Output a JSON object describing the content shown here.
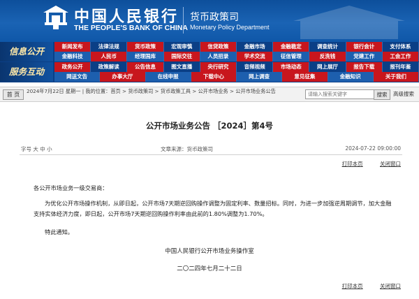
{
  "header": {
    "bank_cn": "中国人民银行",
    "bank_en": "THE PEOPLE'S BANK OF CHINA",
    "dept_cn": "货币政策司",
    "dept_en": "Monetary Policy Department"
  },
  "nav": {
    "group1_label": "信息公开",
    "group2_label": "服务互动",
    "row1": [
      "新闻发布",
      "法律法规",
      "货币政策",
      "宏观审慎",
      "信贷政策",
      "金融市场",
      "金融稳定",
      "调查统计",
      "银行会计",
      "支付体系"
    ],
    "row2": [
      "金融科技",
      "人民币",
      "经理国库",
      "国际交往",
      "人员招录",
      "学术交流",
      "征信管理",
      "反洗钱",
      "党建工作",
      "工会工作"
    ],
    "row3": [
      "政务公开",
      "政策解读",
      "公告信息",
      "图文直播",
      "央行研究",
      "音频视频",
      "市场动态",
      "网上展厅",
      "报告下载",
      "报刊年鉴"
    ],
    "row4": [
      "网送文告",
      "办事大厅",
      "在线申报",
      "下载中心",
      "网上调查",
      "意见征集",
      "金融知识",
      "关于我们"
    ]
  },
  "breadcrumb": {
    "home_label": "首 页",
    "text": "2024年7月22日 星期一 | 我的位置：首页 > 货币政策司 > 货币政策工具 > 公开市场业务 > 公开市场业务公告",
    "search_placeholder": "请输入搜索关键字",
    "search_label": "搜索",
    "advanced_label": "高级搜索"
  },
  "article": {
    "title": "公开市场业务公告 ［2024］第4号",
    "author": "字号  大  中  小",
    "source": "文章来源：货币政策司",
    "date": "2024-07-22  09:00:00",
    "print_label": "打印本页",
    "close_label": "关闭窗口",
    "greeting": "各公开市场业务一级交易商：",
    "paragraph1": "为优化公开市场操作机制，从即日起，公开市场7天期逆回购操作调整为固定利率、数量招标。同时，为进一步加强逆周期调节，加大金融支持实体经济力度，即日起，公开市场7天期逆回购操作利率由此前的1.80%调整为1.70%。",
    "paragraph2": "特此通知。",
    "signature": "中国人民银行公开市场业务操作室",
    "sign_date": "二〇二四年七月二十二日"
  }
}
